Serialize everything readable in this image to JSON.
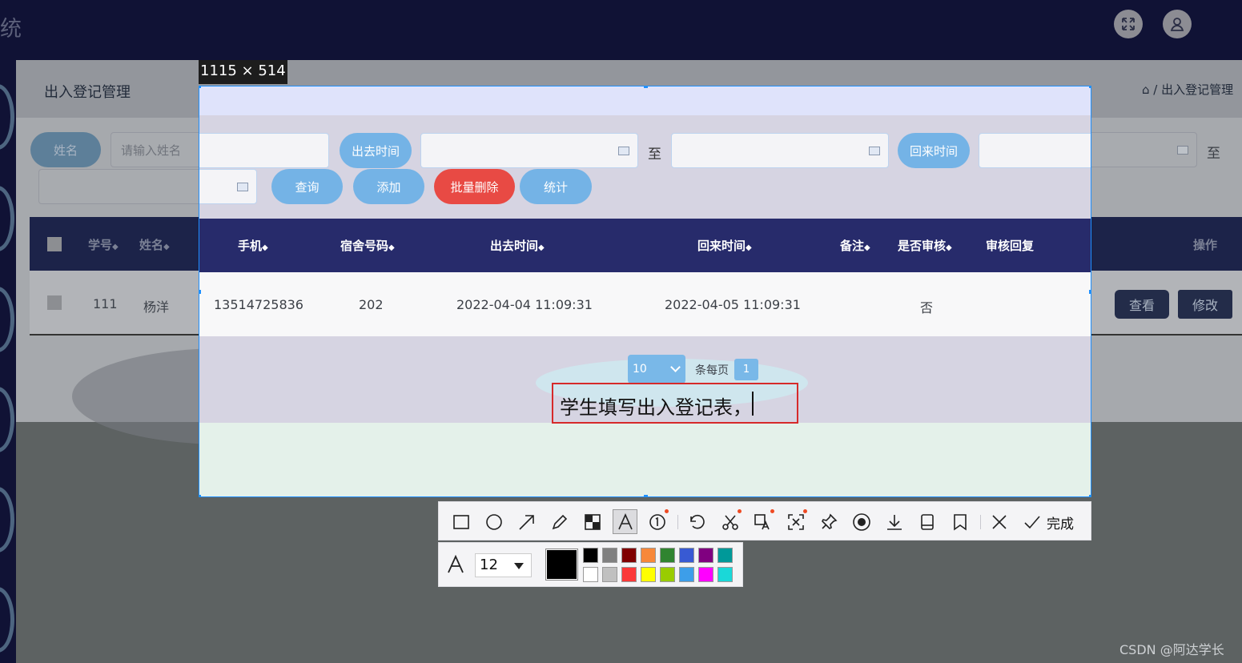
{
  "app": {
    "title_fragment": "统"
  },
  "page": {
    "title": "出入登记管理",
    "breadcrumb": "/ 出入登记管理"
  },
  "search": {
    "name_label": "姓名",
    "name_placeholder": "请输入姓名",
    "out_time_label": "出去时间",
    "back_time_label": "回来时间",
    "range_sep": "至",
    "query_button": "查询",
    "add_button": "添加",
    "batch_delete_button": "批量删除",
    "stats_button": "统计"
  },
  "table": {
    "headers": [
      "学号",
      "姓名",
      "手机",
      "宿舍号码",
      "出去时间",
      "回来时间",
      "备注",
      "是否审核",
      "审核回复",
      "操作"
    ],
    "sort_mark": "◆",
    "rows": [
      {
        "student_id": "111",
        "name": "杨洋",
        "phone": "13514725836",
        "dorm": "202",
        "out_time": "2022-04-04 11:09:31",
        "back_time": "2022-04-05 11:09:31",
        "note": "",
        "audited": "否",
        "reply": "",
        "view_button": "查看",
        "edit_button": "修改"
      }
    ]
  },
  "pagination": {
    "page_size": "10",
    "per_page_label": "条每页",
    "current_page": "1"
  },
  "screenshot_tool": {
    "size_label": "1115 × 514",
    "text_annotation": "学生填写出入登记表，",
    "done_label": "完成",
    "font_size": "12",
    "current_color": "#000000",
    "tools": [
      "rectangle-icon",
      "ellipse-icon",
      "arrow-icon",
      "pencil-icon",
      "mosaic-icon",
      "text-icon",
      "number-marker-icon",
      "undo-icon",
      "scissors-icon",
      "ocr-icon",
      "scan-icon",
      "pin-icon",
      "record-icon",
      "download-icon",
      "save-icon",
      "bookmark-icon",
      "close-icon",
      "check-icon"
    ],
    "palette_row1": [
      "#000000",
      "#808080",
      "#800000",
      "#f7883a",
      "#308430",
      "#385ad3",
      "#800080",
      "#009999"
    ],
    "palette_row2": [
      "#ffffff",
      "#c0c0c0",
      "#fb3838",
      "#ffff00",
      "#99cc00",
      "#3d9ee9",
      "#ff00ff",
      "#1ad8d8"
    ]
  },
  "watermark": "CSDN @阿达学长",
  "colors": {
    "header_bg": "#101235",
    "table_header": "#272b6b",
    "accent_blue": "#74b3e6",
    "danger": "#e84a44",
    "selection_border": "#1e90ff"
  }
}
